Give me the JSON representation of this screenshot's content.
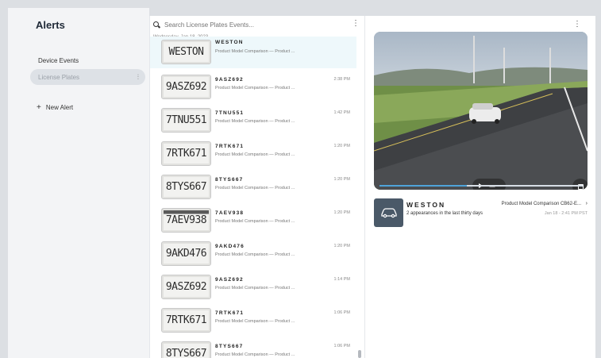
{
  "sidebar": {
    "title": "Alerts",
    "items": [
      {
        "label": "Device Events"
      },
      {
        "label": "License Plates"
      }
    ],
    "new_alert": "New Alert"
  },
  "search": {
    "placeholder": "Search License Plates Events..."
  },
  "list": {
    "date_header": "Wednesday, Jan 18, 2023",
    "rows": [
      {
        "plate": "WESTON",
        "thumb": "WESTON",
        "desc": "Product Model Comparison — Product ...",
        "time": ""
      },
      {
        "plate": "9ASZ692",
        "thumb": "9ASZ692",
        "desc": "Product Model Comparison — Product ...",
        "time": "2:38 PM"
      },
      {
        "plate": "7TNU551",
        "thumb": "7TNU551",
        "desc": "Product Model Comparison — Product ...",
        "time": "1:42 PM"
      },
      {
        "plate": "7RTK671",
        "thumb": "7RTK671",
        "desc": "Product Model Comparison — Product ...",
        "time": "1:20 PM"
      },
      {
        "plate": "8TYS667",
        "thumb": "8TYS667",
        "desc": "Product Model Comparison — Product ...",
        "time": "1:20 PM"
      },
      {
        "plate": "7AEV938",
        "thumb": "7AEV938",
        "desc": "Product Model Comparison — Product ...",
        "time": "1:20 PM"
      },
      {
        "plate": "9AKD476",
        "thumb": "9AKD476",
        "desc": "Product Model Comparison — Product ...",
        "time": "1:20 PM"
      },
      {
        "plate": "9ASZ692",
        "thumb": "9ASZ692",
        "desc": "Product Model Comparison — Product ...",
        "time": "1:14 PM"
      },
      {
        "plate": "7RTK671",
        "thumb": "7RTK671",
        "desc": "Product Model Comparison — Product ...",
        "time": "1:06 PM"
      },
      {
        "plate": "8TYS667",
        "thumb": "8TYS667",
        "desc": "Product Model Comparison — Product ...",
        "time": "1:06 PM"
      }
    ]
  },
  "detail": {
    "plate": "WESTON",
    "appearances": "2 appearances in the last thirty days",
    "camera": "Product Model Comparison CB62-E...",
    "date": "Jan 18 - 2:41 PM PST",
    "progress": 0.43
  },
  "icons": {
    "search": "search-icon",
    "pin": "pin-icon",
    "plus": "plus-icon",
    "kebab": "kebab-icon",
    "play": "play-icon",
    "fullscreen": "fullscreen-icon",
    "vehicle": "car-icon",
    "chevron": "chevron-right-icon"
  },
  "colors": {
    "accent": "#4fa3d9",
    "vehicle_tile": "#4a5968",
    "selected_row": "#eef8fb"
  }
}
